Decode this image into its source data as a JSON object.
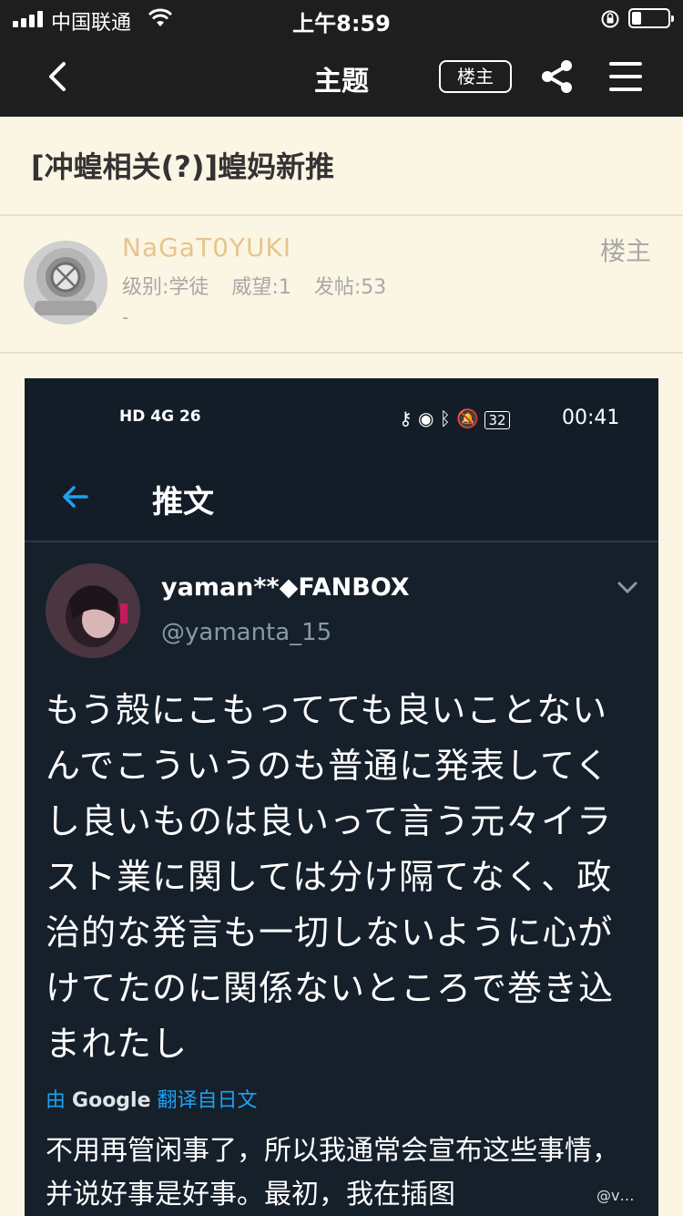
{
  "status_bar": {
    "carrier": "中国联通",
    "time": "上午8:59"
  },
  "nav": {
    "title": "主题",
    "owner_button": "楼主"
  },
  "thread": {
    "title": "[冲蝗相关(?)]蝗妈新推"
  },
  "author": {
    "username": "NaGaT0YUKI",
    "level": "级别:学徒",
    "prestige": "威望:1",
    "posts": "发帖:53",
    "signature": "-",
    "tag": "楼主"
  },
  "embedded_screenshot": {
    "status_left": "HD 4G 26",
    "status_time": "00:41",
    "battery": "32",
    "header_title": "推文",
    "tweet": {
      "display_name": "yaman**◆FANBOX",
      "handle": "@yamanta_15",
      "text": "もう殻にこもってても良いことないんでこういうのも普通に発表してくし良いものは良いって言う元々イラスト業に関しては分け隔てなく、政治的な発言も一切しないように心がけてたのに関係ないところで巻き込まれたし",
      "translated_prefix": "由",
      "translated_brand": "Google",
      "translated_suffix": "翻译自日文",
      "translation": "不用再管闲事了，所以我通常会宣布这些事情，并说好事是好事。最初，我在插图"
    }
  },
  "watermark": "@v…"
}
